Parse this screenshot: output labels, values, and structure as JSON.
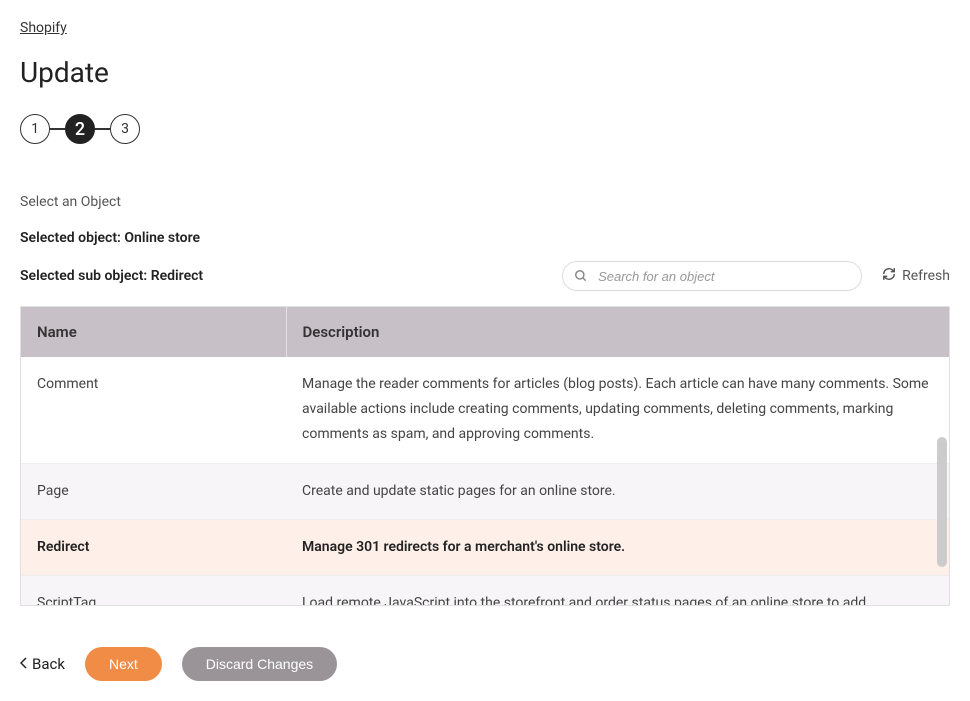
{
  "breadcrumb": "Shopify",
  "title": "Update",
  "stepper": {
    "steps": [
      "1",
      "2",
      "3"
    ],
    "active": 1
  },
  "section_label": "Select an Object",
  "selected_object_label": "Selected object: Online store",
  "selected_sub_object_label": "Selected sub object: Redirect",
  "search": {
    "placeholder": "Search for an object"
  },
  "refresh_label": "Refresh",
  "table": {
    "headers": [
      "Name",
      "Description"
    ],
    "rows": [
      {
        "name": "Comment",
        "description": "Manage the reader comments for articles (blog posts). Each article can have many comments. Some available actions include creating comments, updating comments, deleting comments, marking comments as spam, and approving comments.",
        "selected": false
      },
      {
        "name": "Page",
        "description": "Create and update static pages for an online store.",
        "selected": false
      },
      {
        "name": "Redirect",
        "description": "Manage 301 redirects for a merchant's online store.",
        "selected": true
      },
      {
        "name": "ScriptTag",
        "description": "Load remote JavaScript into the storefront and order status pages of an online store to add",
        "selected": false
      }
    ]
  },
  "footer": {
    "back": "Back",
    "next": "Next",
    "discard": "Discard Changes"
  }
}
